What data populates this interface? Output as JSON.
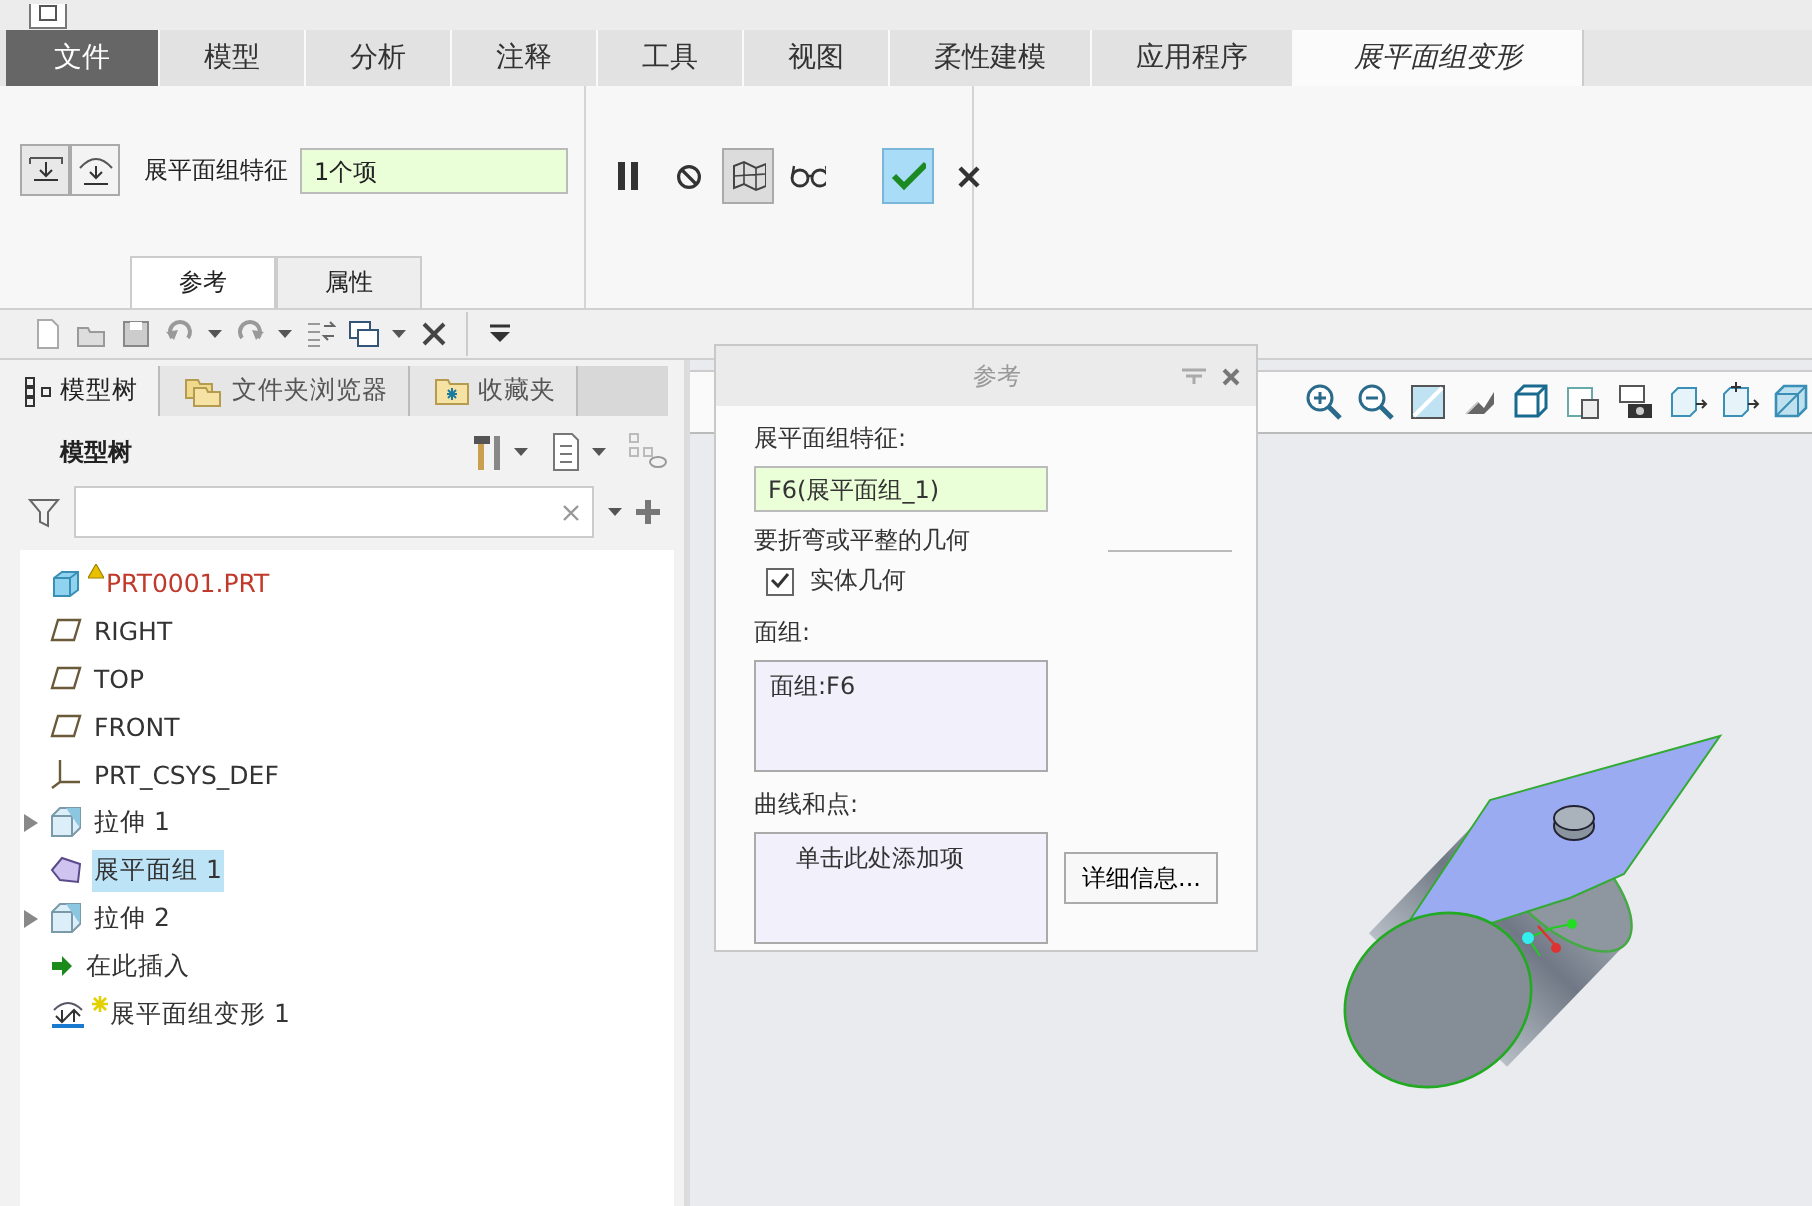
{
  "ribbon_tabs": [
    {
      "label": "文件",
      "kind": "file",
      "selected": false
    },
    {
      "label": "模型",
      "kind": "tab",
      "selected": false
    },
    {
      "label": "分析",
      "kind": "tab",
      "selected": false
    },
    {
      "label": "注释",
      "kind": "tab",
      "selected": false
    },
    {
      "label": "工具",
      "kind": "tab",
      "selected": false
    },
    {
      "label": "视图",
      "kind": "tab",
      "selected": false
    },
    {
      "label": "柔性建模",
      "kind": "tab",
      "selected": false
    },
    {
      "label": "应用程序",
      "kind": "tab",
      "selected": false
    },
    {
      "label": "展平面组变形",
      "kind": "tab",
      "selected": true
    }
  ],
  "dashboard": {
    "feature_label": "展平面组特征",
    "feature_value": "1个项",
    "tabs": [
      {
        "label": "参考",
        "selected": true
      },
      {
        "label": "属性",
        "selected": false
      }
    ],
    "tools": [
      {
        "kind": "pause",
        "pressed": false
      },
      {
        "kind": "disable",
        "pressed": false
      },
      {
        "kind": "preview",
        "pressed": true
      },
      {
        "kind": "glasses",
        "pressed": false
      },
      {
        "kind": "apply",
        "pressed": true
      },
      {
        "kind": "cancel",
        "pressed": false
      }
    ]
  },
  "navigator": {
    "tabs": [
      {
        "label": "模型树",
        "selected": true
      },
      {
        "label": "文件夹浏览器",
        "selected": false
      },
      {
        "label": "收藏夹",
        "selected": false
      }
    ],
    "title": "模型树",
    "tree": [
      {
        "label": "PRT0001.PRT",
        "kind": "part",
        "warning": true,
        "new": false,
        "expandable": false,
        "selected": false
      },
      {
        "label": "RIGHT",
        "kind": "plane",
        "warning": false,
        "new": false,
        "expandable": false,
        "selected": false
      },
      {
        "label": "TOP",
        "kind": "plane",
        "warning": false,
        "new": false,
        "expandable": false,
        "selected": false
      },
      {
        "label": "FRONT",
        "kind": "plane",
        "warning": false,
        "new": false,
        "expandable": false,
        "selected": false
      },
      {
        "label": "PRT_CSYS_DEF",
        "kind": "csys",
        "warning": false,
        "new": false,
        "expandable": false,
        "selected": false
      },
      {
        "label": "拉伸 1",
        "kind": "extrude",
        "warning": false,
        "new": false,
        "expandable": true,
        "selected": false
      },
      {
        "label": "展平面组 1",
        "kind": "quilt",
        "warning": false,
        "new": false,
        "expandable": false,
        "selected": true
      },
      {
        "label": "拉伸 2",
        "kind": "extrude",
        "warning": false,
        "new": false,
        "expandable": true,
        "selected": false
      },
      {
        "label": "在此插入",
        "kind": "insert",
        "warning": false,
        "new": false,
        "expandable": false,
        "selected": false
      },
      {
        "label": "展平面组变形 1",
        "kind": "deform",
        "warning": false,
        "new": true,
        "expandable": false,
        "selected": false
      }
    ]
  },
  "dialog": {
    "title": "参考",
    "feature_label": "展平面组特征:",
    "feature_value": "F6(展平面组_1)",
    "geometry_label": "要折弯或平整的几何",
    "solid_checkbox": {
      "label": "实体几何",
      "checked": true
    },
    "quilts_label": "面组:",
    "quilts": [
      "面组:F6"
    ],
    "curves_label": "曲线和点:",
    "curves_prompt": "单击此处添加项",
    "details_button": "详细信息..."
  }
}
